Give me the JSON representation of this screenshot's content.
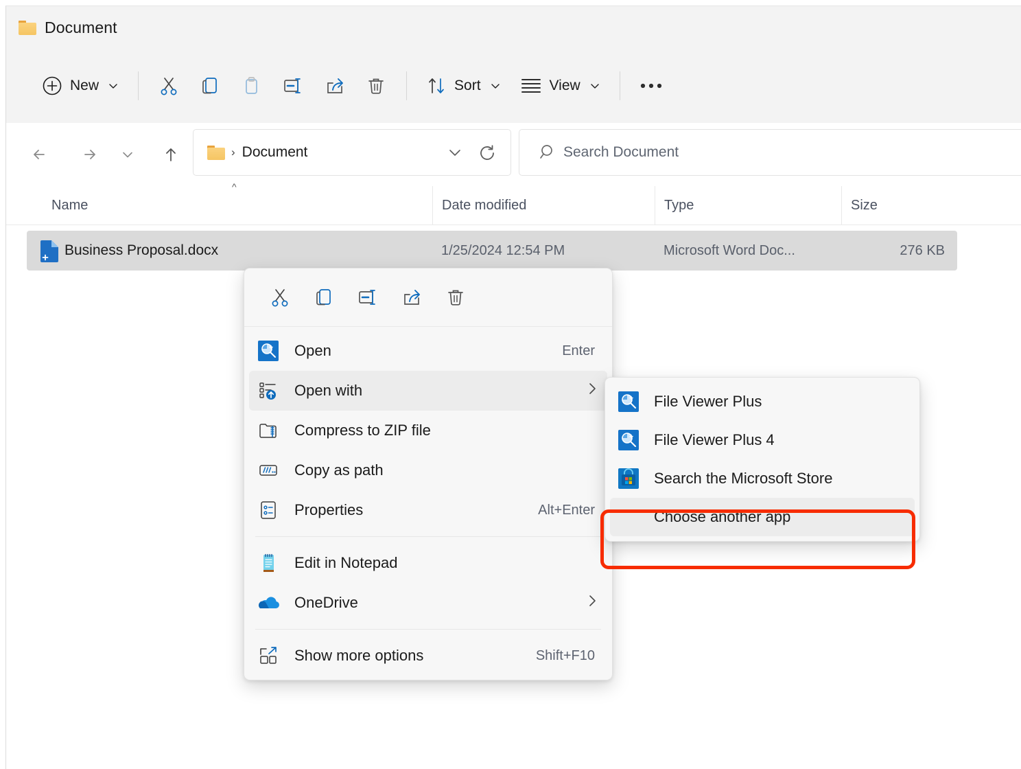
{
  "window": {
    "title": "Document",
    "folder_icon": "folder-icon"
  },
  "toolbar": {
    "new_label": "New",
    "sort_label": "Sort",
    "view_label": "View",
    "buttons": [
      {
        "name": "new-button",
        "label": "New",
        "icon": "plus-circle-icon"
      },
      {
        "name": "cut-button",
        "label": "Cut",
        "icon": "scissors-icon"
      },
      {
        "name": "copy-button",
        "label": "Copy",
        "icon": "copy-icon"
      },
      {
        "name": "paste-button",
        "label": "Paste",
        "icon": "clipboard-icon"
      },
      {
        "name": "rename-button",
        "label": "Rename",
        "icon": "rename-icon"
      },
      {
        "name": "share-button",
        "label": "Share",
        "icon": "share-icon"
      },
      {
        "name": "delete-button",
        "label": "Delete",
        "icon": "trash-icon"
      },
      {
        "name": "sort-button",
        "label": "Sort",
        "icon": "sort-arrows-icon"
      },
      {
        "name": "view-button",
        "label": "View",
        "icon": "view-lines-icon"
      },
      {
        "name": "more-button",
        "label": "See more",
        "icon": "ellipsis-icon"
      }
    ]
  },
  "navigation": {
    "back": "Back",
    "forward": "Forward",
    "recent": "Recent locations",
    "up": "Up",
    "breadcrumb_separator": "›",
    "breadcrumb": "Document",
    "refresh": "Refresh"
  },
  "search": {
    "placeholder": "Search Document",
    "value": ""
  },
  "columns": [
    {
      "name": "name",
      "label": "Name"
    },
    {
      "name": "date-modified",
      "label": "Date modified"
    },
    {
      "name": "type",
      "label": "Type"
    },
    {
      "name": "size",
      "label": "Size"
    }
  ],
  "files": [
    {
      "name": "Business Proposal.docx",
      "date_modified": "1/25/2024 12:54 PM",
      "type": "Microsoft Word Doc...",
      "size": "276 KB",
      "selected": true
    }
  ],
  "context_menu": {
    "toolbar": [
      {
        "name": "ctx-cut-button",
        "label": "Cut",
        "icon": "scissors-icon"
      },
      {
        "name": "ctx-copy-button",
        "label": "Copy",
        "icon": "copy-icon"
      },
      {
        "name": "ctx-rename-button",
        "label": "Rename",
        "icon": "rename-icon"
      },
      {
        "name": "ctx-share-button",
        "label": "Share",
        "icon": "share-icon"
      },
      {
        "name": "ctx-delete-button",
        "label": "Delete",
        "icon": "trash-icon"
      }
    ],
    "items": [
      {
        "label": "Open",
        "accel": "Enter",
        "icon": "file-viewer-plus-icon",
        "submenu": false,
        "highlighted": false
      },
      {
        "label": "Open with",
        "accel": "",
        "icon": "open-with-icon",
        "submenu": true,
        "highlighted": true
      },
      {
        "label": "Compress to ZIP file",
        "accel": "",
        "icon": "zip-folder-icon",
        "submenu": false,
        "highlighted": false
      },
      {
        "label": "Copy as path",
        "accel": "",
        "icon": "copy-path-icon",
        "submenu": false,
        "highlighted": false
      },
      {
        "label": "Properties",
        "accel": "Alt+Enter",
        "icon": "properties-icon",
        "submenu": false,
        "highlighted": false
      },
      {
        "label": "Edit in Notepad",
        "accel": "",
        "icon": "notepad-icon",
        "submenu": false,
        "highlighted": false
      },
      {
        "label": "OneDrive",
        "accel": "",
        "icon": "onedrive-cloud-icon",
        "submenu": true,
        "highlighted": false
      },
      {
        "label": "Show more options",
        "accel": "Shift+F10",
        "icon": "show-more-options-icon",
        "submenu": false,
        "highlighted": false
      }
    ]
  },
  "submenu": {
    "items": [
      {
        "label": "File Viewer Plus",
        "icon": "file-viewer-plus-icon",
        "selected": false
      },
      {
        "label": "File Viewer Plus 4",
        "icon": "file-viewer-plus-icon",
        "selected": false
      },
      {
        "label": "Search the Microsoft Store",
        "icon": "microsoft-store-icon",
        "selected": false
      },
      {
        "label": "Choose another app",
        "icon": "none",
        "selected": true
      }
    ]
  },
  "annotation": {
    "target": "Choose another app",
    "color": "#f72c00"
  },
  "colors": {
    "accent": "#0f6cbd",
    "selection": "#dadada",
    "chrome": "#f3f3f3",
    "menu_bg": "#f7f7f7",
    "highlight": "#ececec"
  }
}
